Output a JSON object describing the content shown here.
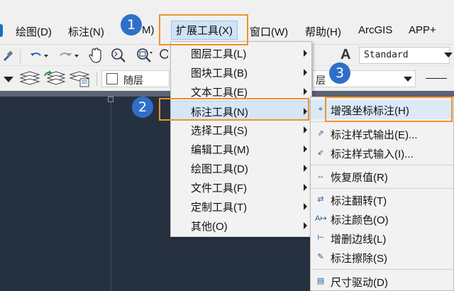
{
  "colors": {
    "menu_highlight": "#cfe3f7",
    "callout_blue": "#2f6fc7",
    "annotation_orange": "#f0922b",
    "canvas_dark": "#263140"
  },
  "menubar": {
    "items": [
      {
        "label": "绘图(D)",
        "icon": ""
      },
      {
        "label": "标注(N)",
        "icon": ""
      },
      {
        "label": "M)"
      },
      {
        "label": "扩展工具(X)"
      },
      {
        "label": "窗口(W)"
      },
      {
        "label": "帮助(H)"
      },
      {
        "label": "ArcGIS"
      },
      {
        "label": "APP+"
      }
    ]
  },
  "toolbar": {
    "text_style_value": "Standard",
    "layer_value": "随层",
    "combo2_value": "层",
    "combo3_value": "隨"
  },
  "dropdown": {
    "items": [
      {
        "label": "图层工具(L)",
        "has_submenu": true
      },
      {
        "label": "图块工具(B)",
        "has_submenu": true
      },
      {
        "label": "文本工具(E)",
        "has_submenu": true
      },
      {
        "label": "标注工具(N)",
        "has_submenu": true,
        "highlighted": true
      },
      {
        "label": "选择工具(S)",
        "has_submenu": true
      },
      {
        "label": "编辑工具(M)",
        "has_submenu": true
      },
      {
        "label": "绘图工具(D)",
        "has_submenu": true
      },
      {
        "label": "文件工具(F)",
        "has_submenu": true
      },
      {
        "label": "定制工具(T)",
        "has_submenu": true
      },
      {
        "label": "其他(O)",
        "has_submenu": true
      }
    ]
  },
  "submenu": {
    "items": [
      {
        "label": "增强坐标标注(H)",
        "icon": "coordinate-dimension-icon",
        "highlighted": true
      },
      {
        "label": "标注样式输出(E)...",
        "icon": "dim-style-export-icon"
      },
      {
        "label": "标注样式输入(I)...",
        "icon": "dim-style-import-icon"
      },
      {
        "label": "恢复原值(R)",
        "icon": "restore-value-icon"
      },
      {
        "label": "标注翻转(T)",
        "icon": "dim-flip-icon"
      },
      {
        "label": "标注颜色(O)",
        "icon": "dim-color-icon"
      },
      {
        "label": "增删边线(L)",
        "icon": "edit-extension-line-icon"
      },
      {
        "label": "标注擦除(S)",
        "icon": "dim-erase-icon"
      },
      {
        "label": "尺寸驱动(D)",
        "icon": "dimension-drive-icon"
      }
    ]
  },
  "callouts": [
    "1",
    "2",
    "3"
  ]
}
